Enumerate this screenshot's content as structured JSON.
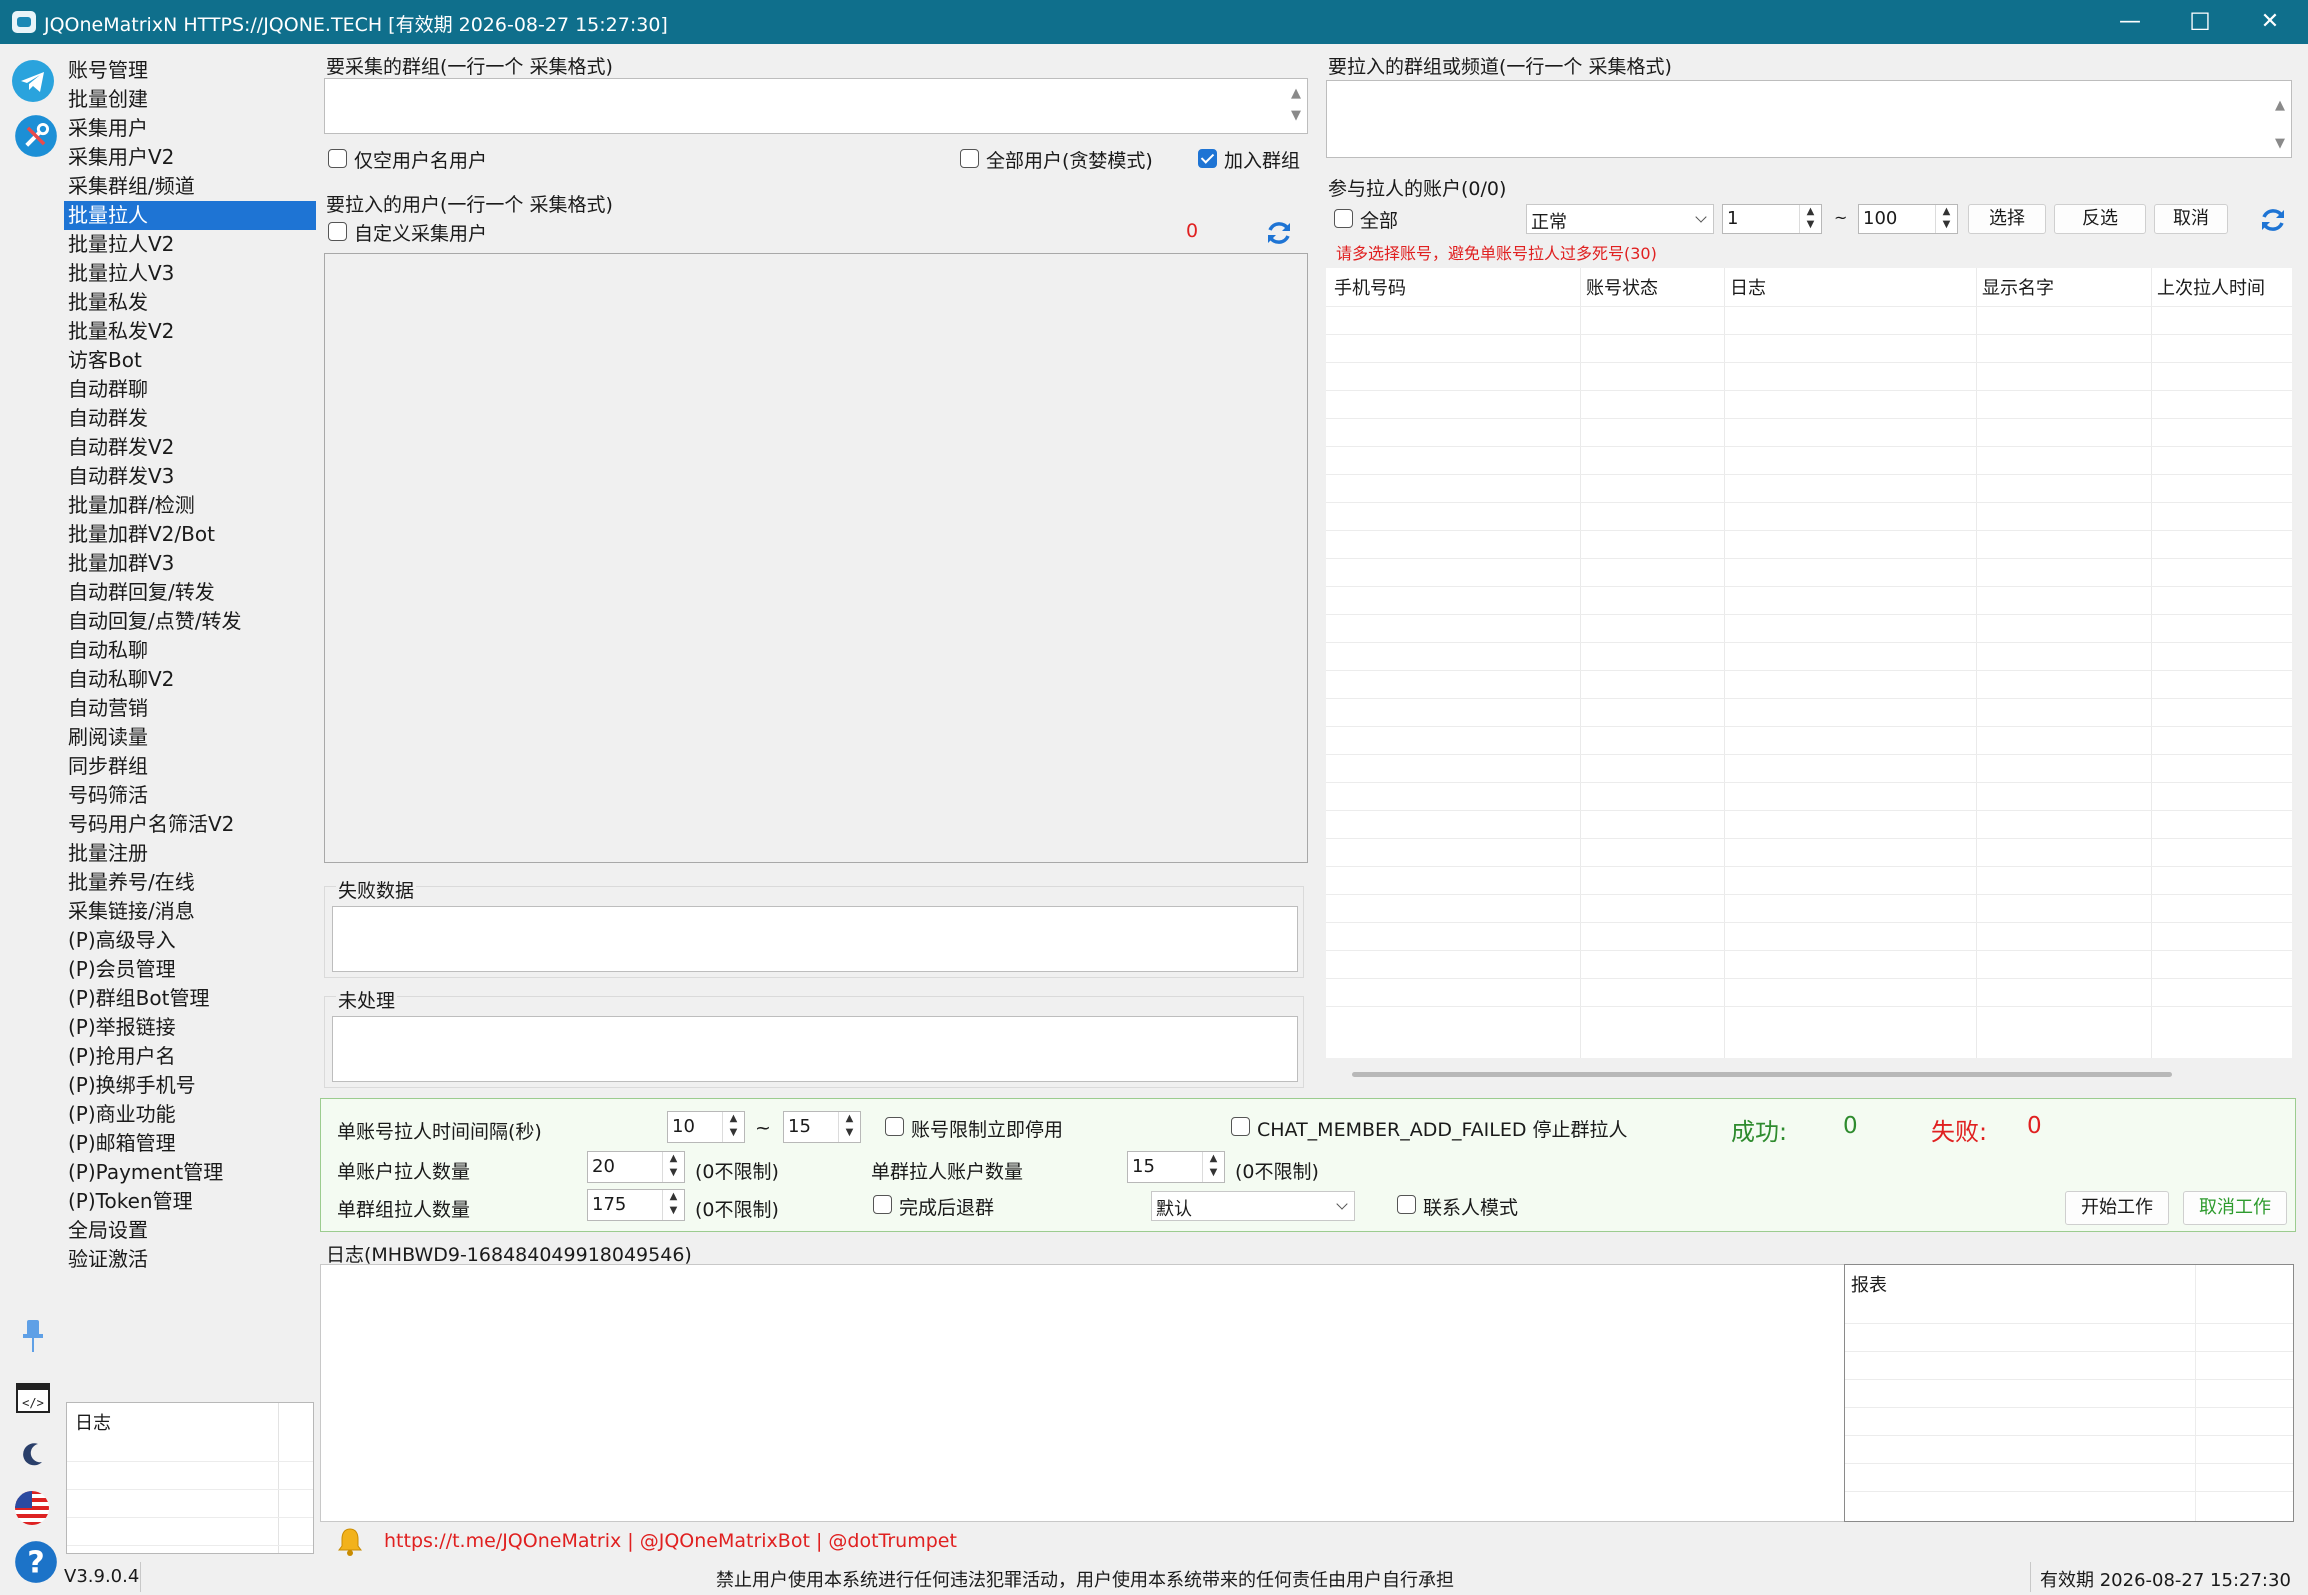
{
  "window": {
    "title": "JQOneMatrixN HTTPS://JQONE.TECH  [有效期 2026-08-27 15:27:30]",
    "minimize": "—",
    "maximize": "☐",
    "close": "✕"
  },
  "iconbar": [
    "telegram-icon",
    "tools-icon",
    "pin-icon",
    "code-icon",
    "moon-icon",
    "us-flag-icon",
    "help-icon"
  ],
  "menu": {
    "active_index": 5,
    "items": [
      "账号管理",
      "批量创建",
      "采集用户",
      "采集用户V2",
      "采集群组/频道",
      "批量拉人",
      "批量拉人V2",
      "批量拉人V3",
      "批量私发",
      "批量私发V2",
      "访客Bot",
      "自动群聊",
      "自动群发",
      "自动群发V2",
      "自动群发V3",
      "批量加群/检测",
      "批量加群V2/Bot",
      "批量加群V3",
      "自动群回复/转发",
      "自动回复/点赞/转发",
      "自动私聊",
      "自动私聊V2",
      "自动营销",
      "刷阅读量",
      "同步群组",
      "号码筛活",
      "号码用户名筛活V2",
      "批量注册",
      "批量养号/在线",
      "采集链接/消息",
      "(P)高级导入",
      "(P)会员管理",
      "(P)群组Bot管理",
      "(P)举报链接",
      "(P)抢用户名",
      "(P)换绑手机号",
      "(P)商业功能",
      "(P)邮箱管理",
      "(P)Payment管理",
      "(P)Token管理",
      "全局设置",
      "验证激活"
    ]
  },
  "sidelog": {
    "header": "日志"
  },
  "version": "V3.9.0.4",
  "source_groups": {
    "label": "要采集的群组(一行一个 采集格式)",
    "value": "",
    "only_username_label": "仅空用户名用户",
    "only_username_checked": false,
    "all_users_label": "全部用户(贪婪模式)",
    "all_users_checked": false,
    "join_group_label": "加入群组",
    "join_group_checked": true
  },
  "target_users": {
    "label": "要拉入的用户(一行一个 采集格式)",
    "custom_label": "自定义采集用户",
    "custom_checked": false,
    "count": "0",
    "value": ""
  },
  "failed": {
    "label": "失败数据",
    "value": ""
  },
  "unprocessed": {
    "label": "未处理",
    "value": ""
  },
  "target_groups": {
    "label": "要拉入的群组或频道(一行一个 采集格式)",
    "value": ""
  },
  "accounts": {
    "label": "参与拉人的账户(0/0)",
    "all_label": "全部",
    "all_checked": false,
    "status_value": "正常",
    "range_from": "1",
    "range_sep": "~",
    "range_to": "100",
    "select_btn": "选择",
    "invert_btn": "反选",
    "cancel_btn": "取消",
    "warning": "请多选择账号，避免单账号拉人过多死号(30)",
    "columns": [
      "手机号码",
      "账号状态",
      "日志",
      "显示名字",
      "上次拉人时间"
    ]
  },
  "settings": {
    "interval_label": "单账号拉人时间间隔(秒)",
    "interval_min": "10",
    "interval_sep": "~",
    "interval_max": "15",
    "limit_stop_label": "账号限制立即停用",
    "limit_stop_checked": false,
    "chat_member_label": "CHAT_MEMBER_ADD_FAILED 停止群拉人",
    "chat_member_checked": false,
    "success_label": "成功:",
    "success_value": "0",
    "fail_label": "失败:",
    "fail_value": "0",
    "per_account_label": "单账户拉人数量",
    "per_account_value": "20",
    "per_account_hint": "(0不限制)",
    "per_group_accounts_label": "单群拉人账户数量",
    "per_group_accounts_value": "15",
    "per_group_accounts_hint": "(0不限制)",
    "per_group_label": "单群组拉人数量",
    "per_group_value": "175",
    "per_group_hint": "(0不限制)",
    "leave_label": "完成后退群",
    "leave_checked": false,
    "mode_value": "默认",
    "contact_label": "联系人模式",
    "contact_checked": false,
    "start_btn": "开始工作",
    "cancel_btn": "取消工作"
  },
  "log": {
    "label": "日志(MHBWD9-168484049918049546)",
    "report_header": "报表"
  },
  "footer": {
    "links": "https://t.me/JQOneMatrix | @JQOneMatrixBot | @dotTrumpet",
    "disclaimer": "禁止用户使用本系统进行任何违法犯罪活动，用户使用本系统带来的任何责任由用户自行承担",
    "expiry": "有效期 2026-08-27 15:27:30"
  },
  "colors": {
    "titlebar": "#0f6f8c",
    "accent": "#1e74d4",
    "success": "#2e8b2e",
    "fail": "#e02020",
    "warning": "#e02020"
  }
}
